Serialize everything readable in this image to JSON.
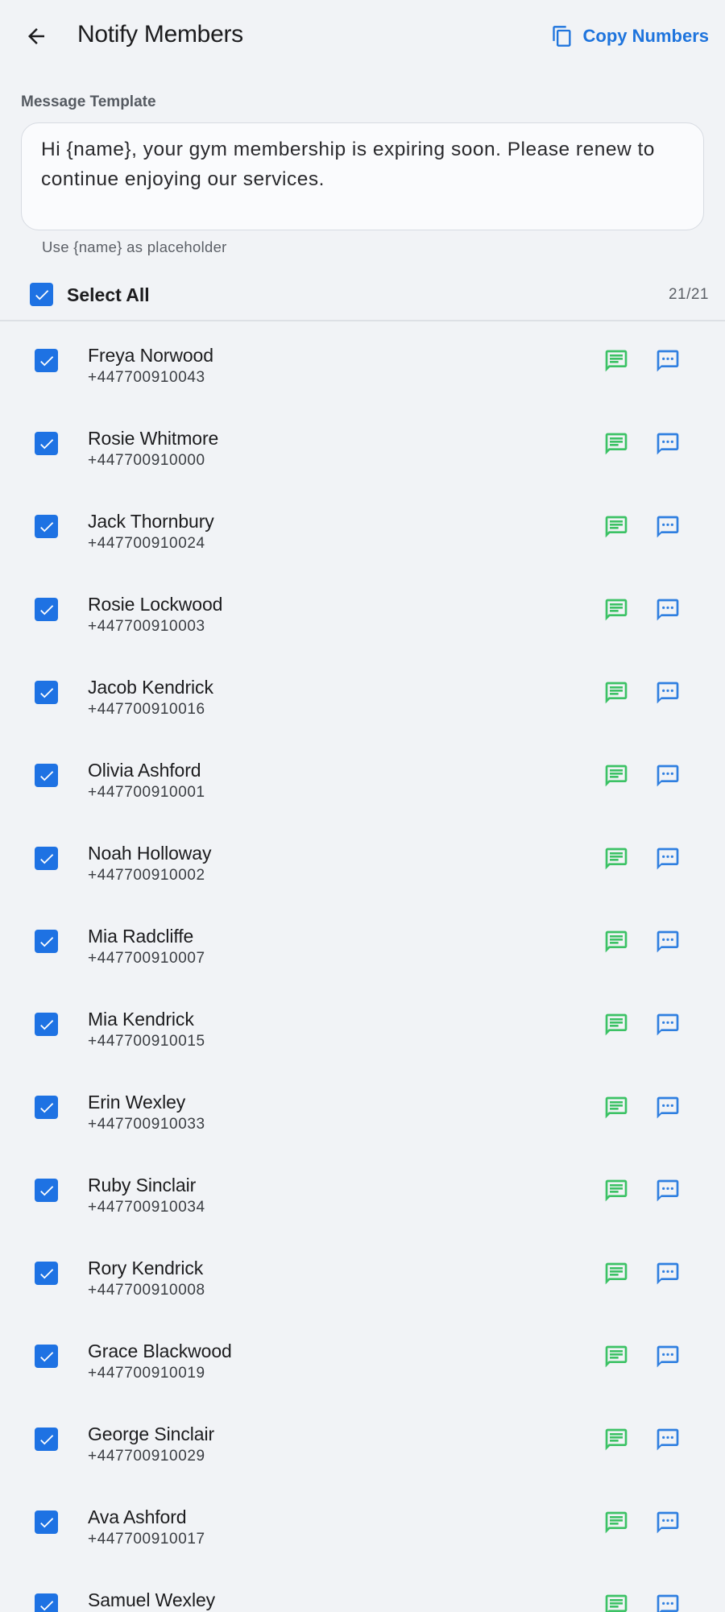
{
  "header": {
    "title": "Notify Members",
    "copy_label": "Copy Numbers",
    "back_icon": "arrow-back-icon",
    "copy_icon": "copy-icon"
  },
  "template": {
    "label": "Message Template",
    "value": "Hi {name}, your gym membership is expiring soon. Please renew to continue enjoying our services.",
    "hint": "Use {name} as placeholder"
  },
  "select_all": {
    "label": "Select All",
    "count": "21/21",
    "checked": true
  },
  "colors": {
    "accent": "#1e72e3",
    "sms_green": "#3cc265",
    "message_blue": "#2f7fe0",
    "background": "#f1f3f6"
  },
  "members": [
    {
      "name": "Freya Norwood",
      "phone": "+447700910043",
      "checked": true
    },
    {
      "name": "Rosie Whitmore",
      "phone": "+447700910000",
      "checked": true
    },
    {
      "name": "Jack Thornbury",
      "phone": "+447700910024",
      "checked": true
    },
    {
      "name": "Rosie Lockwood",
      "phone": "+447700910003",
      "checked": true
    },
    {
      "name": "Jacob Kendrick",
      "phone": "+447700910016",
      "checked": true
    },
    {
      "name": "Olivia Ashford",
      "phone": "+447700910001",
      "checked": true
    },
    {
      "name": "Noah Holloway",
      "phone": "+447700910002",
      "checked": true
    },
    {
      "name": "Mia Radcliffe",
      "phone": "+447700910007",
      "checked": true
    },
    {
      "name": "Mia Kendrick",
      "phone": "+447700910015",
      "checked": true
    },
    {
      "name": "Erin Wexley",
      "phone": "+447700910033",
      "checked": true
    },
    {
      "name": "Ruby Sinclair",
      "phone": "+447700910034",
      "checked": true
    },
    {
      "name": "Rory Kendrick",
      "phone": "+447700910008",
      "checked": true
    },
    {
      "name": "Grace Blackwood",
      "phone": "+447700910019",
      "checked": true
    },
    {
      "name": "George Sinclair",
      "phone": "+447700910029",
      "checked": true
    },
    {
      "name": "Ava Ashford",
      "phone": "+447700910017",
      "checked": true
    },
    {
      "name": "Samuel Wexley",
      "phone": "",
      "checked": true
    }
  ]
}
